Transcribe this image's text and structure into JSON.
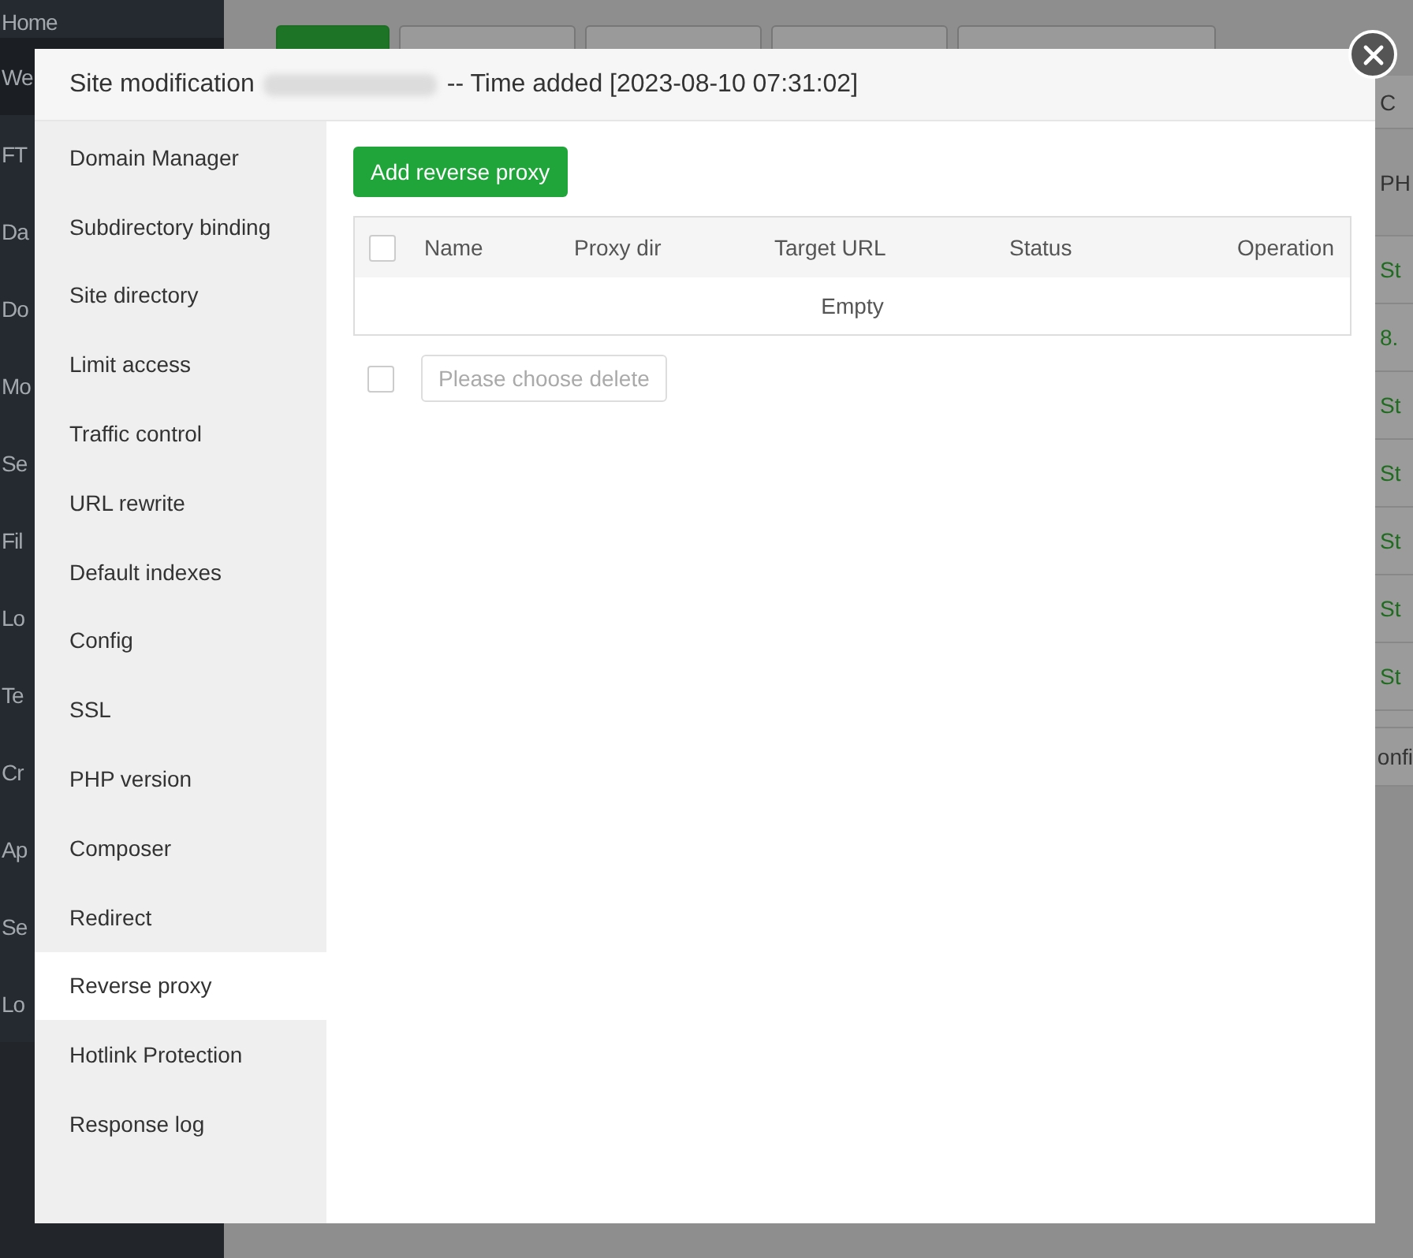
{
  "background": {
    "nav": [
      {
        "label": "Home",
        "selected": false
      },
      {
        "label": "We",
        "selected": true
      },
      {
        "label": "FT",
        "selected": false
      },
      {
        "label": "Da",
        "selected": false
      },
      {
        "label": "Do",
        "selected": false
      },
      {
        "label": "Mo",
        "selected": false
      },
      {
        "label": "Se",
        "selected": false
      },
      {
        "label": "Fil",
        "selected": false
      },
      {
        "label": "Lo",
        "selected": false
      },
      {
        "label": "Te",
        "selected": false
      },
      {
        "label": "Cr",
        "selected": false
      },
      {
        "label": "Ap",
        "selected": false
      },
      {
        "label": "Se",
        "selected": false
      },
      {
        "label": "Lo",
        "selected": false
      }
    ],
    "toolbar": [
      {
        "kind": "primary"
      },
      {
        "kind": "plain"
      },
      {
        "kind": "plain"
      },
      {
        "kind": "plain"
      },
      {
        "kind": "dropdown"
      }
    ],
    "table": {
      "tab": "C",
      "column": "PH",
      "rows": [
        {
          "text": "St"
        },
        {
          "text": "8."
        },
        {
          "text": "St"
        },
        {
          "text": "St"
        },
        {
          "text": "St"
        },
        {
          "text": "St"
        },
        {
          "text": "St"
        }
      ],
      "footer": "onfi"
    }
  },
  "dialog": {
    "title": "Site modification",
    "title_suffix": "-- Time added [2023-08-10 07:31:02]",
    "menu": [
      {
        "label": "Domain Manager",
        "selected": false
      },
      {
        "label": "Subdirectory binding",
        "selected": false
      },
      {
        "label": "Site directory",
        "selected": false
      },
      {
        "label": "Limit access",
        "selected": false
      },
      {
        "label": "Traffic control",
        "selected": false
      },
      {
        "label": "URL rewrite",
        "selected": false
      },
      {
        "label": "Default indexes",
        "selected": false
      },
      {
        "label": "Config",
        "selected": false
      },
      {
        "label": "SSL",
        "selected": false
      },
      {
        "label": "PHP version",
        "selected": false
      },
      {
        "label": "Composer",
        "selected": false
      },
      {
        "label": "Redirect",
        "selected": false
      },
      {
        "label": "Reverse proxy",
        "selected": true
      },
      {
        "label": "Hotlink Protection",
        "selected": false
      },
      {
        "label": "Response log",
        "selected": false
      }
    ],
    "add_button": "Add reverse proxy",
    "table": {
      "select_all": {
        "checked": false
      },
      "columns": [
        "Name",
        "Proxy dir",
        "Target URL",
        "Status",
        "Operation"
      ],
      "empty_text": "Empty"
    },
    "batch": {
      "checked": false,
      "button": "Please choose delete",
      "disabled": true
    }
  }
}
